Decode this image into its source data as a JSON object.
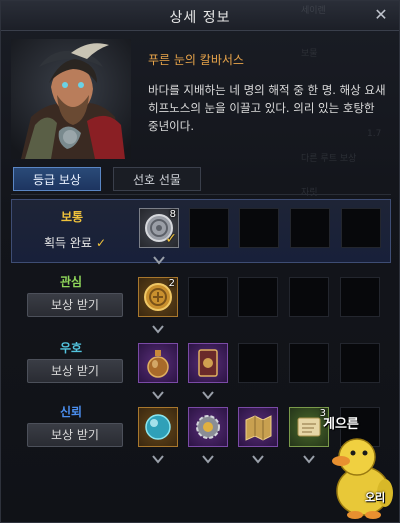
{
  "window": {
    "title": "상세 정보",
    "close_icon": "close-icon",
    "faded_header_text": "세이렌"
  },
  "npc": {
    "name": "푸른 눈의 칼바서스",
    "description": "바다를 지배하는 네 명의 해적 중 한 명. 해상 요새 히프노스의 눈을 이끌고 있다. 의리 있는 호탕한 중년이다."
  },
  "tabs": [
    {
      "label": "등급 보상",
      "active": true
    },
    {
      "label": "선호 선물",
      "active": false
    }
  ],
  "faded_background_text": [
    "보물",
    "1.7",
    "다른 루트 보상",
    "자릿"
  ],
  "tiers": [
    {
      "name": "보통",
      "color": "#f0c23b",
      "status_text": "획득 완료",
      "claim_label": "",
      "items": [
        {
          "icon": "silver-coin-icon",
          "count": "8",
          "claimed": true
        }
      ]
    },
    {
      "name": "관심",
      "color": "#8fd65a",
      "claim_label": "보상 받기",
      "items": [
        {
          "icon": "gold-coin-icon",
          "count": "2"
        }
      ]
    },
    {
      "name": "우호",
      "color": "#53c4de",
      "claim_label": "보상 받기",
      "items": [
        {
          "icon": "potion-flask-icon",
          "count": ""
        },
        {
          "icon": "card-pack-icon",
          "count": ""
        }
      ]
    },
    {
      "name": "신뢰",
      "color": "#4b8ff0",
      "claim_label": "보상 받기",
      "items": [
        {
          "icon": "crystal-orb-icon",
          "count": ""
        },
        {
          "icon": "gear-gem-icon",
          "count": ""
        },
        {
          "icon": "map-scroll-icon",
          "count": ""
        },
        {
          "icon": "parchment-scroll-icon",
          "count": "3"
        }
      ]
    }
  ],
  "watermark": {
    "text_top": "게으른",
    "text_bottom": "오리",
    "mascot_icon": "duck-mascot-icon"
  }
}
